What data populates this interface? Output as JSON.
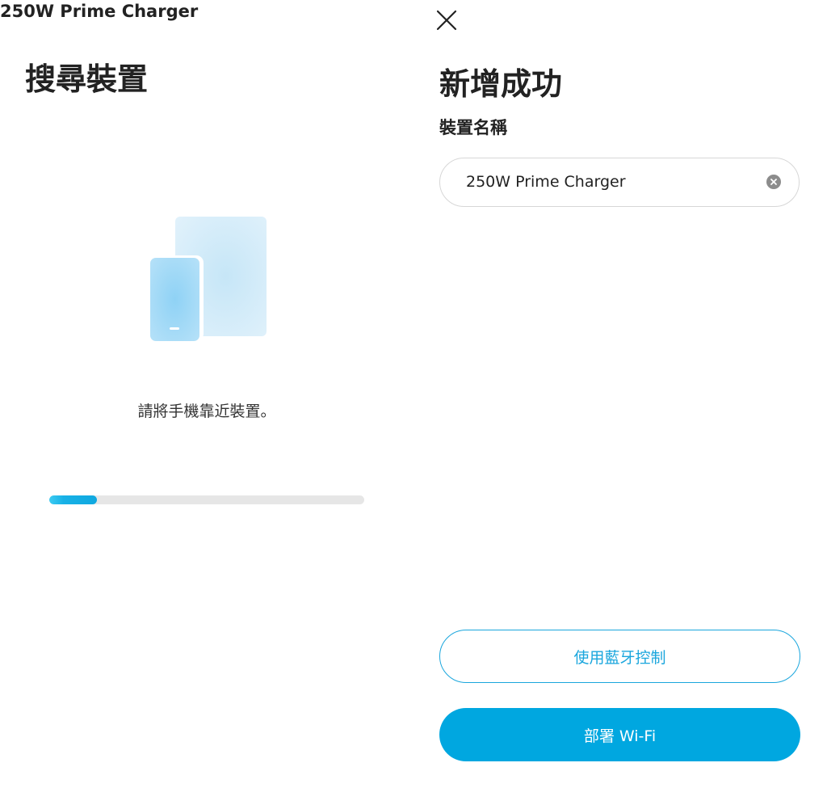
{
  "search_screen": {
    "title": "搜尋裝置",
    "device_name": "250W Prime Charger",
    "hint": "請將手機靠近裝置。",
    "progress_fraction": 0.15,
    "illustration_icon": "phone-near-tablet-icon"
  },
  "success_screen": {
    "close_icon": "close-icon",
    "title": "新增成功",
    "name_label": "裝置名稱",
    "name_value": "250W Prime Charger",
    "clear_icon": "clear-input-icon",
    "bluetooth_button_label": "使用藍牙控制",
    "wifi_button_label": "部署 Wi-Fi"
  },
  "colors": {
    "accent": "#00a7e0",
    "progress_track": "#e6e6e6",
    "text": "#222222",
    "illustration_light": "#d6ecf8",
    "illustration_phone": "#a9dcf6"
  }
}
